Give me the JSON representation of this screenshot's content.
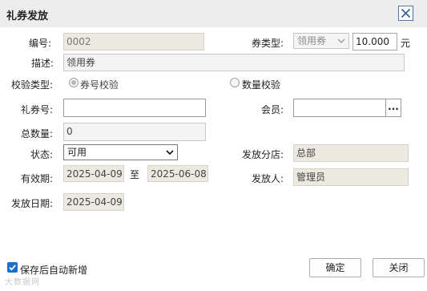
{
  "window": {
    "title": "礼券发放"
  },
  "labels": {
    "number": "编号:",
    "coupon_type": "券类型:",
    "description": "描述:",
    "verify_type": "校验类型:",
    "coupon_no": "礼券号:",
    "member": "会员:",
    "total": "总数量:",
    "status": "状态:",
    "branch": "发放分店:",
    "validity": "有效期:",
    "to": "至",
    "issuer": "发放人:",
    "issue_date": "发放日期:"
  },
  "fields": {
    "number": "0002",
    "coupon_type": "领用券",
    "amount": "10.000",
    "amount_unit": "元",
    "description": "领用券",
    "coupon_no": "",
    "member": "",
    "member_lookup": "...",
    "total": "0",
    "status": "可用",
    "branch": "总部",
    "valid_from": "2025-04-09",
    "valid_to": "2025-06-08",
    "issuer": "管理员",
    "issue_date": "2025-04-09"
  },
  "verify_options": [
    {
      "label": "券号校验",
      "selected": true
    },
    {
      "label": "数量校验",
      "selected": false
    }
  ],
  "footer": {
    "auto_new_label": "保存后自动新增",
    "auto_new_checked": true,
    "ok_label": "确定",
    "close_label": "关闭",
    "watermark": "大数据网"
  },
  "colors": {
    "accent": "#1b6fd1",
    "readonly_bg": "#ece9e1",
    "titlebar": "#ededed"
  },
  "icons": {
    "close": "close-icon",
    "dropdown": "chevron-down-icon",
    "checkbox": "checkmark-icon"
  }
}
